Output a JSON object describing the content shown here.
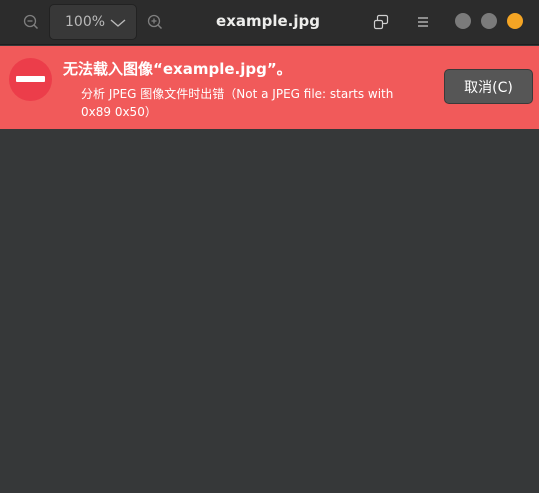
{
  "header": {
    "title": "example.jpg",
    "zoom_value": "100%",
    "icons": {
      "zoom_out": "zoom-out-icon",
      "zoom_in": "zoom-in-icon",
      "zoom_dropdown": "chevron-down-icon",
      "fit": "fit-window-icon",
      "menu": "hamburger-menu-icon"
    },
    "window_controls": {
      "minimize_color": "#7b7b7b",
      "maximize_color": "#7b7b7b",
      "close_color": "#f5a524"
    }
  },
  "error_bar": {
    "background": "#f15a5a",
    "icon": "error-icon",
    "title": "无法载入图像“example.jpg”。",
    "detail": "分析 JPEG 图像文件时出错（Not a JPEG file: starts with 0x89 0x50）",
    "cancel_label": "取消(C)"
  }
}
